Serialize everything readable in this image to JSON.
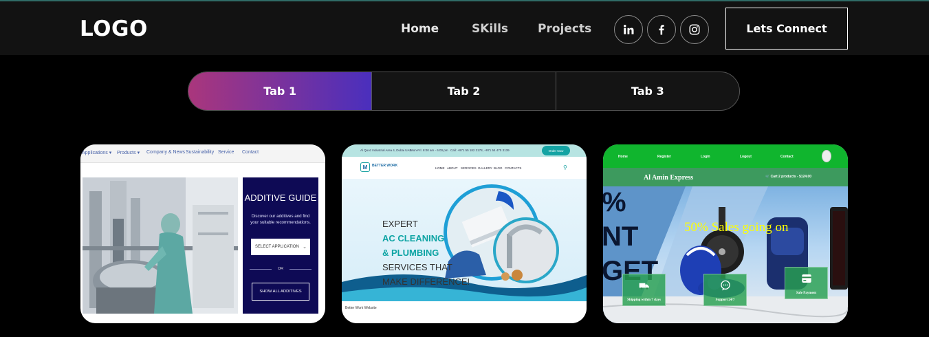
{
  "navbar": {
    "logo": "LOGO",
    "links": [
      "Home",
      "SKills",
      "Projects"
    ],
    "social": [
      "linkedin-icon",
      "facebook-icon",
      "instagram-icon"
    ],
    "cta_label": "Lets Connect"
  },
  "tabs": [
    "Tab 1",
    "Tab 2",
    "Tab 3"
  ],
  "colors": {
    "background": "#000000",
    "navbar": "#121212",
    "tab_gradient_start": "#aa367c",
    "tab_gradient_end": "#4a2fbd"
  },
  "projects": [
    {
      "nav": [
        "Applications ▾",
        "Products ▾",
        "Company & News",
        "Sustainability",
        "Service",
        "Contact"
      ],
      "panel_title": "ADDITIVE GUIDE",
      "panel_text": "Discover our additives and find your suitable recommendations.",
      "select_label": "SELECT APPLICATION",
      "or_label": "OR",
      "button_label": "SHOW ALL ADDITIVES"
    },
    {
      "topbar": [
        "Al Quoz Industrial Area 4, Dubai UAE",
        "Mon-Fri: 8:00 am - 6:00 pm",
        "Call: +971 55 182 3178, +971 54 470 3139"
      ],
      "order_label": "Order Now",
      "brand": "BETTER WORK",
      "nav": [
        "HOME",
        "ABOUT",
        "SERVICES",
        "GALLERY",
        "BLOG",
        "CONTACTS"
      ],
      "headline": [
        "EXPERT",
        "AC CLEANING",
        "& PLUMBING",
        "SERVICES THAT",
        "MAKE DIFFERENCE!"
      ],
      "caption": "Better Work Website"
    },
    {
      "nav": [
        "Home",
        "Register",
        "Login",
        "Logout",
        "Contact"
      ],
      "brand": "Al Amin Express",
      "cart": "Cart 2 products - $124.00",
      "sale": "50% Sales going on",
      "badges": [
        "Shipping within 7 days",
        "Support 24/7",
        "Safe Payment"
      ]
    }
  ]
}
